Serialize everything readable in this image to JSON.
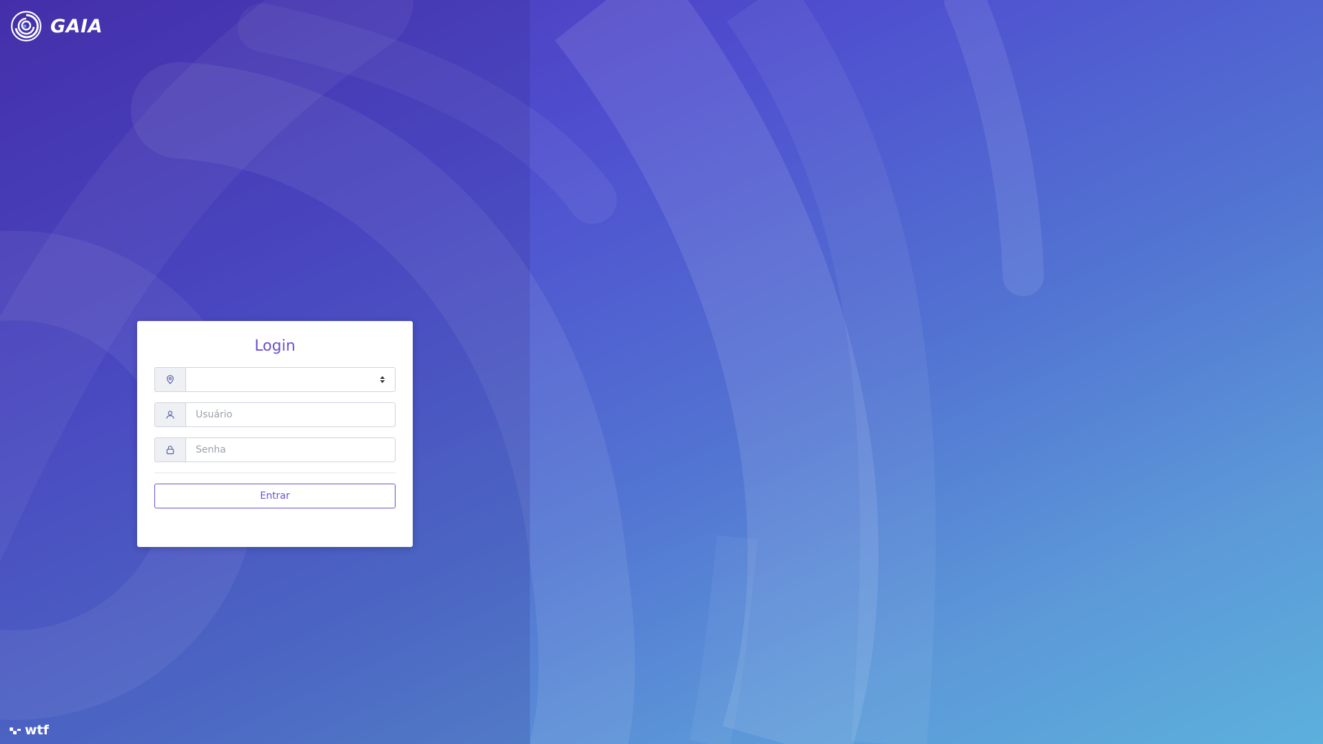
{
  "brand": {
    "name": "GAIA",
    "logo_icon": "spiral-logo-icon"
  },
  "login": {
    "title": "Login",
    "location_select": {
      "icon": "map-pin-icon",
      "selected_value": ""
    },
    "username": {
      "icon": "user-icon",
      "placeholder": "Usuário",
      "value": ""
    },
    "password": {
      "icon": "lock-icon",
      "placeholder": "Senha",
      "value": ""
    },
    "submit_label": "Entrar"
  },
  "footer": {
    "icon": "wtf-logo-icon",
    "text": "wtf"
  },
  "colors": {
    "accent": "#6a4fd3",
    "card_background": "#ffffff",
    "gradient_start": "#4a32b4",
    "gradient_end": "#5cb0dc"
  }
}
